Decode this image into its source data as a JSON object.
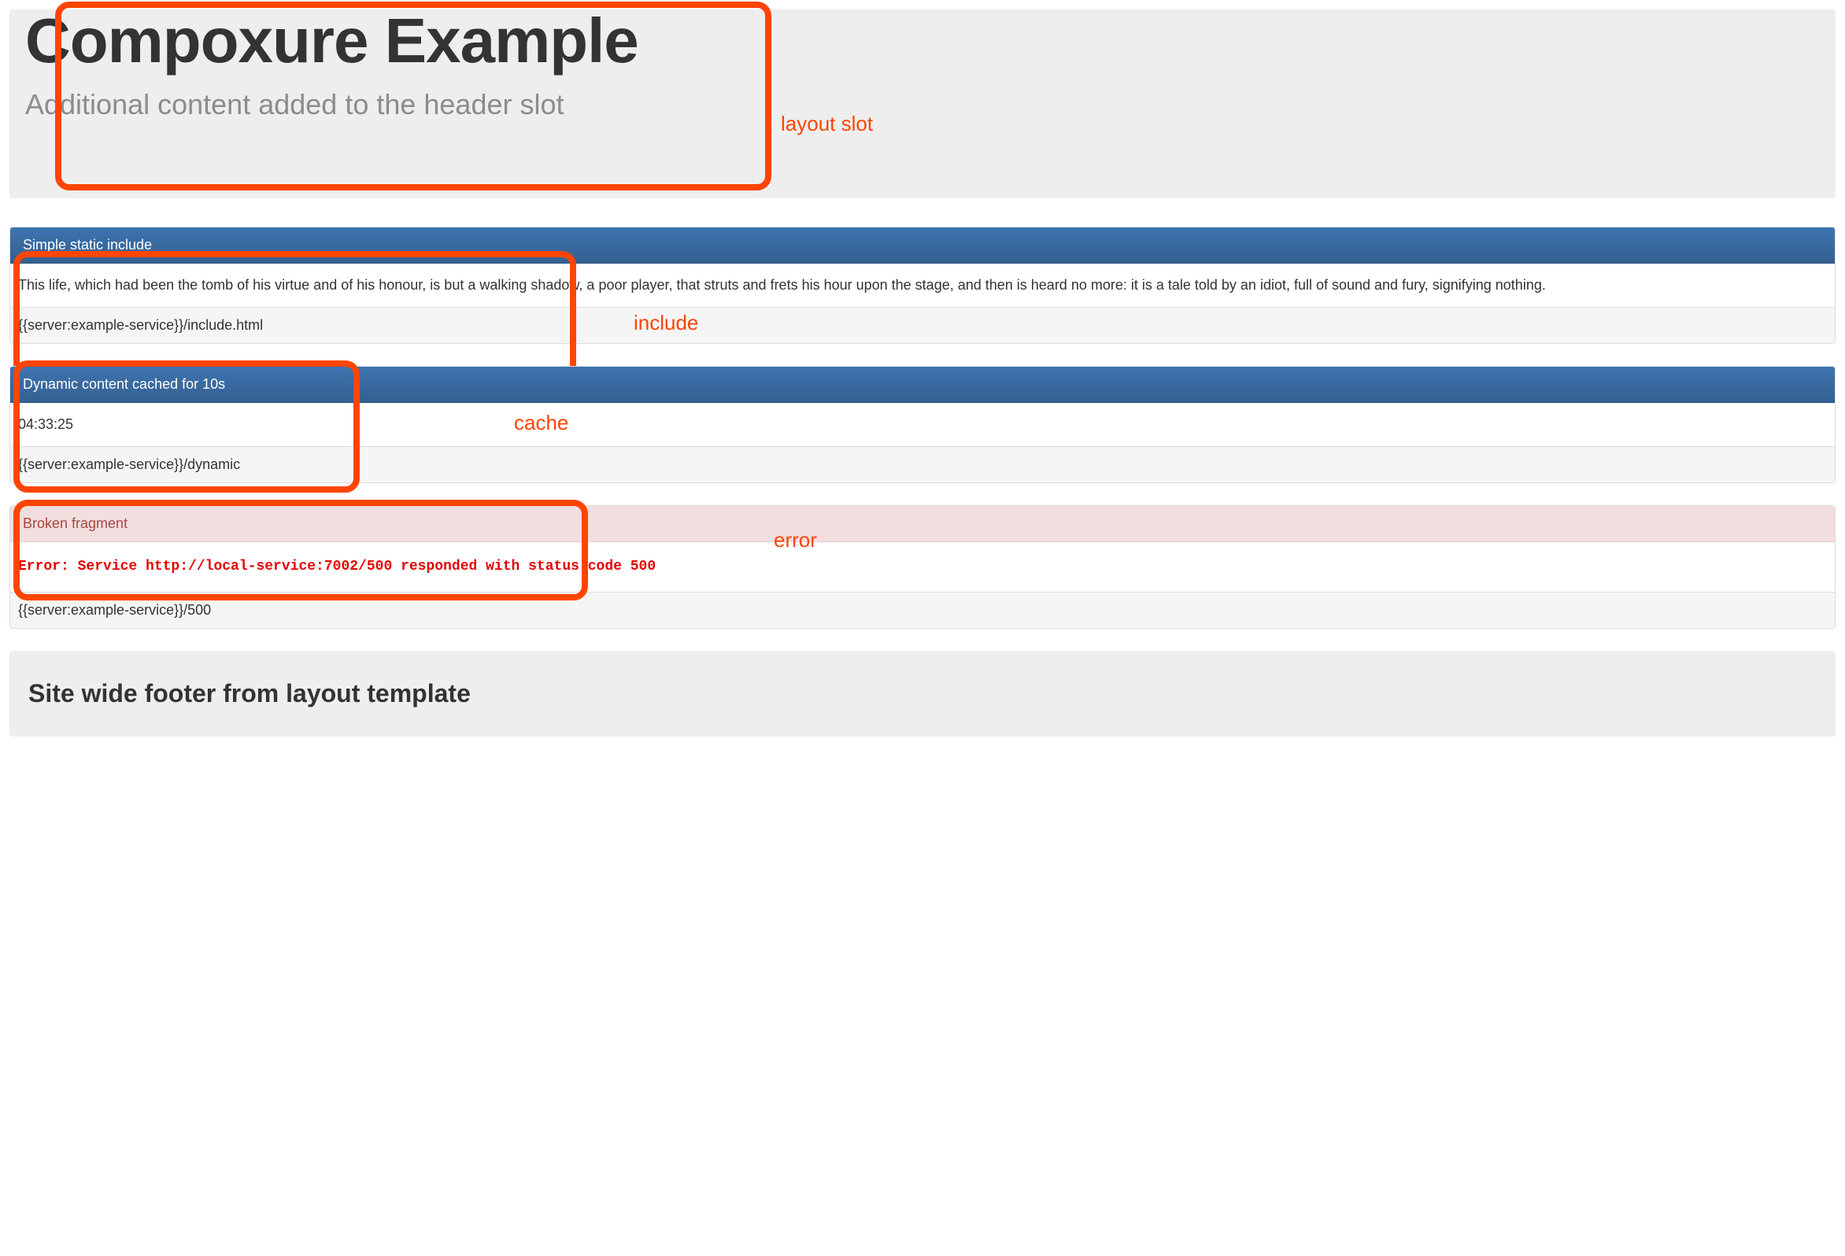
{
  "header": {
    "title": "Compoxure Example",
    "subtitle": "Additional content added to the header slot"
  },
  "annotations": {
    "slot": "layout slot",
    "include": "include",
    "cache": "cache",
    "error": "error"
  },
  "panels": {
    "static": {
      "heading": "Simple static include",
      "body": "This life, which had been the tomb of his virtue and of his honour, is but a walking shadow, a poor player, that struts and frets his hour upon the stage, and then is heard no more: it is a tale told by an idiot, full of sound and fury, signifying nothing.",
      "footer": "{{server:example-service}}/include.html"
    },
    "dynamic": {
      "heading": "Dynamic content cached for 10s",
      "body": "04:33:25",
      "footer": "{{server:example-service}}/dynamic"
    },
    "broken": {
      "heading": "Broken fragment",
      "body": "Error: Service http://local-service:7002/500 responded with status code 500",
      "footer": "{{server:example-service}}/500"
    }
  },
  "footer": {
    "text": "Site wide footer from layout template"
  }
}
